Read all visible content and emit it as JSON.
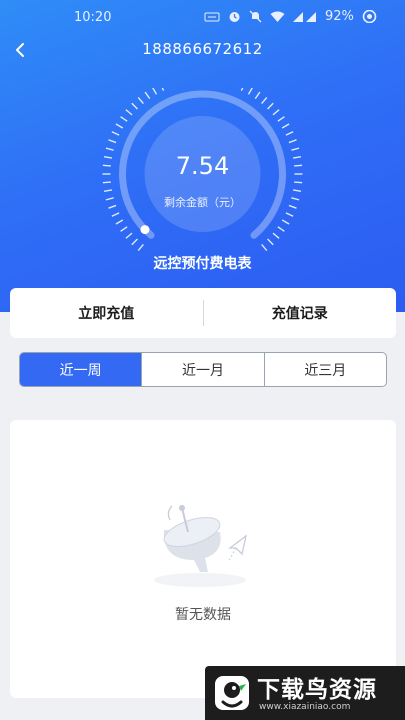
{
  "status_bar": {
    "time": "10:20",
    "battery": "92%",
    "icons": [
      "network-speed-icon",
      "alarm-icon",
      "mute-icon",
      "wifi-icon",
      "signal-icon",
      "eye-icon"
    ]
  },
  "header": {
    "back_icon": "chevron-left-icon",
    "title": "188866672612"
  },
  "meter": {
    "balance_value": "7.54",
    "balance_label": "剩余金额（元）",
    "meter_title": "远控预付费电表"
  },
  "actions": {
    "recharge_label": "立即充值",
    "records_label": "充值记录"
  },
  "tabs": [
    {
      "label": "近一周",
      "active": true
    },
    {
      "label": "近一月",
      "active": false
    },
    {
      "label": "近三月",
      "active": false
    }
  ],
  "empty_state": {
    "icon": "satellite-dish-icon",
    "text": "暂无数据"
  },
  "watermark": {
    "title": "下载鸟资源",
    "url": "www.xiazainiao.com"
  },
  "colors": {
    "header_gradient_start": "#2f8df7",
    "header_gradient_end": "#2c5cf2",
    "tab_active": "#3369f3",
    "background": "#eef0f4"
  }
}
